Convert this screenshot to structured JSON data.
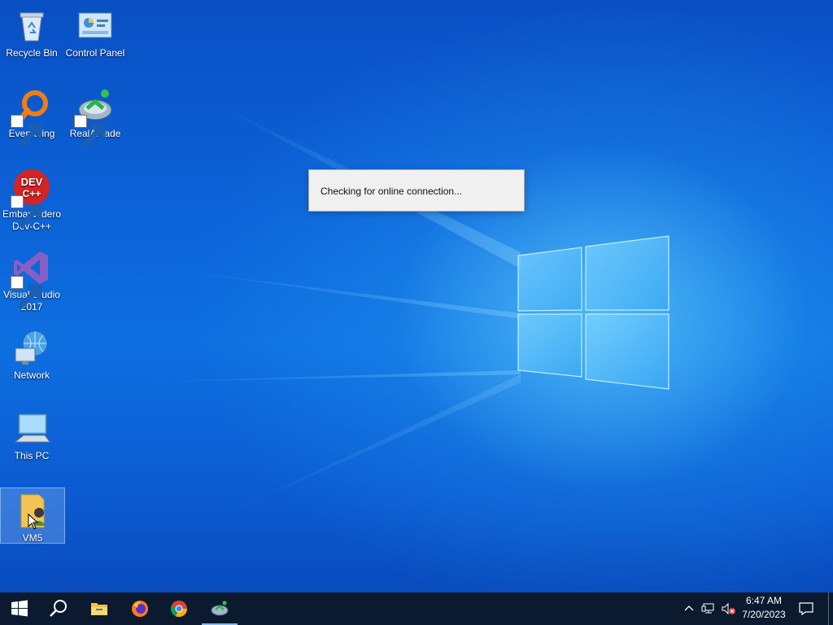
{
  "desktop": {
    "icons": [
      {
        "label": "Recycle Bin",
        "icon": "recycle-bin-icon"
      },
      {
        "label": "Control Panel",
        "icon": "control-panel-icon"
      },
      {
        "label": "Everything",
        "icon": "everything-search-icon"
      },
      {
        "label": "RealArcade",
        "icon": "realarcade-icon"
      },
      {
        "label": "Embarcadero Dev-C++",
        "icon": "devcpp-icon",
        "logo_text": "DEV C++"
      },
      {
        "label": "Visual Studio 2017",
        "icon": "visual-studio-icon"
      },
      {
        "label": "Network",
        "icon": "network-icon"
      },
      {
        "label": "This PC",
        "icon": "this-pc-icon"
      },
      {
        "label": "VM5",
        "icon": "user-folder-icon",
        "selected": true
      }
    ]
  },
  "dialog": {
    "message": "Checking for online connection..."
  },
  "taskbar": {
    "buttons": [
      {
        "name": "start",
        "icon": "windows-start-icon"
      },
      {
        "name": "search",
        "icon": "search-icon"
      },
      {
        "name": "file-explorer",
        "icon": "file-explorer-icon"
      },
      {
        "name": "firefox",
        "icon": "firefox-icon"
      },
      {
        "name": "chrome",
        "icon": "chrome-icon"
      },
      {
        "name": "realarcade",
        "icon": "realarcade-icon",
        "active": true
      }
    ],
    "tray": {
      "icons": [
        "chevron-up-icon",
        "network-status-icon",
        "volume-muted-icon"
      ],
      "time": "6:47 AM",
      "date": "7/20/2023",
      "notification_icon": "action-center-icon"
    }
  },
  "colors": {
    "desktop_blue": "#0c63d8",
    "taskbar": "#0b1a2e",
    "dialog_bg": "#f0f0f0"
  }
}
